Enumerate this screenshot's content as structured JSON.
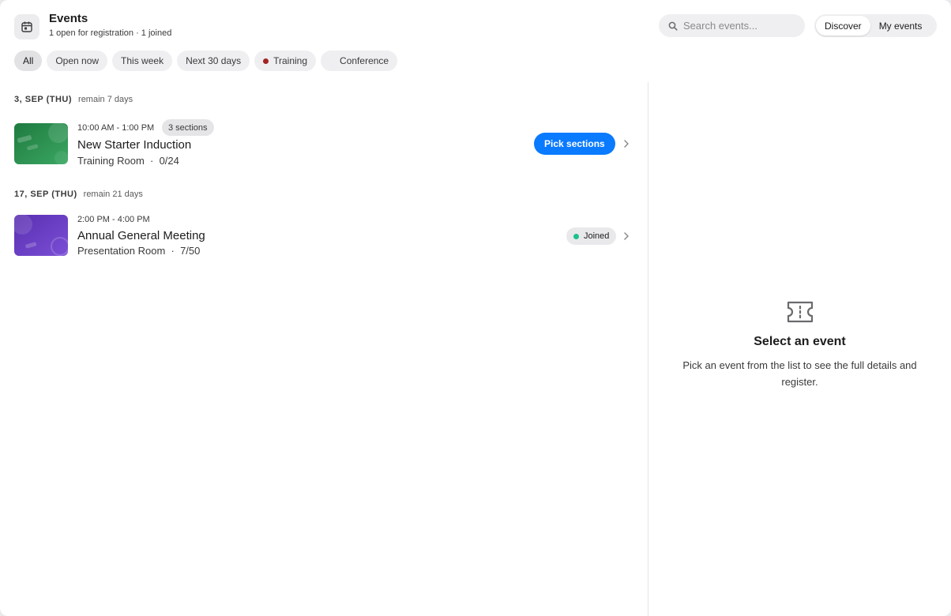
{
  "header": {
    "title": "Events",
    "subtitle": "1 open for registration · 1 joined",
    "search_placeholder": "Search events...",
    "view_tabs": [
      "Discover",
      "My events"
    ]
  },
  "filters": [
    {
      "label": "All",
      "active": true
    },
    {
      "label": "Open now"
    },
    {
      "label": "This week"
    },
    {
      "label": "Next 30 days"
    },
    {
      "label": "Training",
      "dot_color": "#a32424"
    },
    {
      "label": "Conference"
    }
  ],
  "groups": [
    {
      "date": "3, SEP (THU)",
      "remain": "remain 7 days",
      "event": {
        "time": "10:00 AM - 1:00 PM",
        "badge": "3 sections",
        "name": "New Starter Induction",
        "location": "Training Room",
        "capacity": "0/24",
        "action": "Pick sections",
        "thumb_color": "#2e8b4f"
      }
    },
    {
      "date": "17, SEP (THU)",
      "remain": "remain 21 days",
      "event": {
        "time": "2:00 PM - 4:00 PM",
        "name": "Annual General Meeting",
        "location": "Presentation Room",
        "capacity": "7/50",
        "status": "Joined",
        "status_color": "#1cc28a",
        "thumb_color": "#6a3fc4"
      }
    }
  ],
  "empty_state": {
    "title": "Select an event",
    "description": "Pick an event from the list to see the full details and register."
  },
  "colors": {
    "accent": "#0a7aff"
  }
}
